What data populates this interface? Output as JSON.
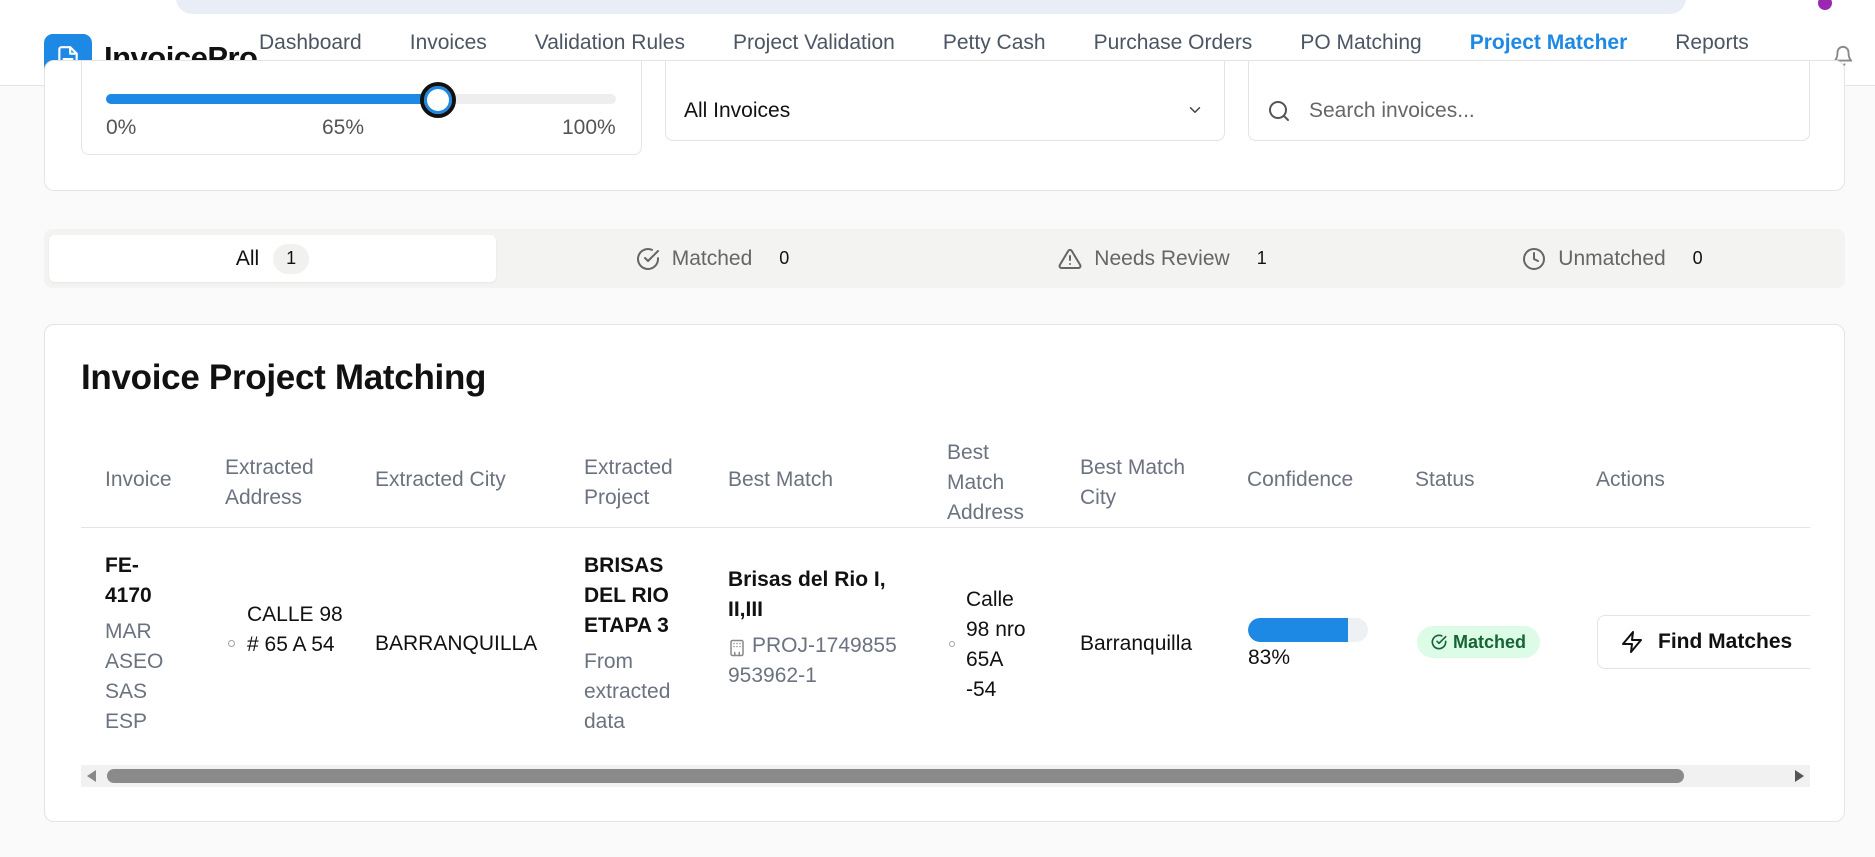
{
  "app": {
    "name": "InvoicePro"
  },
  "nav": {
    "items": [
      {
        "label": "Dashboard",
        "active": false
      },
      {
        "label": "Invoices",
        "active": false
      },
      {
        "label": "Validation Rules",
        "active": false
      },
      {
        "label": "Project Validation",
        "active": false
      },
      {
        "label": "Petty Cash",
        "active": false
      },
      {
        "label": "Purchase Orders",
        "active": false
      },
      {
        "label": "PO Matching",
        "active": false
      },
      {
        "label": "Project Matcher",
        "active": true
      },
      {
        "label": "Reports",
        "active": false
      }
    ]
  },
  "filters": {
    "threshold": {
      "value_percent": 65,
      "min_label": "0%",
      "mid_label": "65%",
      "max_label": "100%"
    },
    "invoice_select": {
      "selected": "All Invoices"
    },
    "search": {
      "placeholder": "Search invoices...",
      "value": ""
    }
  },
  "tabs": [
    {
      "label": "All",
      "count": "1",
      "icon": "none",
      "active": true
    },
    {
      "label": "Matched",
      "count": "0",
      "icon": "check-circle-icon",
      "active": false
    },
    {
      "label": "Needs Review",
      "count": "1",
      "icon": "warning-triangle-icon",
      "active": false
    },
    {
      "label": "Unmatched",
      "count": "0",
      "icon": "clock-icon",
      "active": false
    }
  ],
  "table": {
    "title": "Invoice Project Matching",
    "columns": {
      "invoice": "Invoice",
      "extracted_address": "Extracted Address",
      "extracted_city": "Extracted City",
      "extracted_project": "Extracted Project",
      "best_match": "Best Match",
      "best_match_address": "Best Match Address",
      "best_match_city": "Best Match City",
      "confidence": "Confidence",
      "status": "Status",
      "actions": "Actions"
    },
    "rows": [
      {
        "invoice_number": "FE-4170",
        "vendor": "MAR ASEO SAS ESP",
        "extracted_address": "CALLE 98 # 65 A 54",
        "extracted_city": "BARRANQUILLA",
        "extracted_project": "BRISAS DEL RIO ETAPA 3",
        "extracted_project_note": "From extracted data",
        "best_match_name": "Brisas del Rio I, II,III",
        "best_match_code": "PROJ-1749855953962-1",
        "best_match_address": "Calle 98 nro 65A -54",
        "best_match_city": "Barranquilla",
        "confidence_value": 83,
        "confidence_label": "83%",
        "status": "Matched",
        "status_color": "#dcfce7",
        "action_label": "Find Matches"
      }
    ]
  },
  "colors": {
    "accent": "#1e88e5",
    "success_bg": "#dcfce7",
    "success_text": "#166534"
  }
}
